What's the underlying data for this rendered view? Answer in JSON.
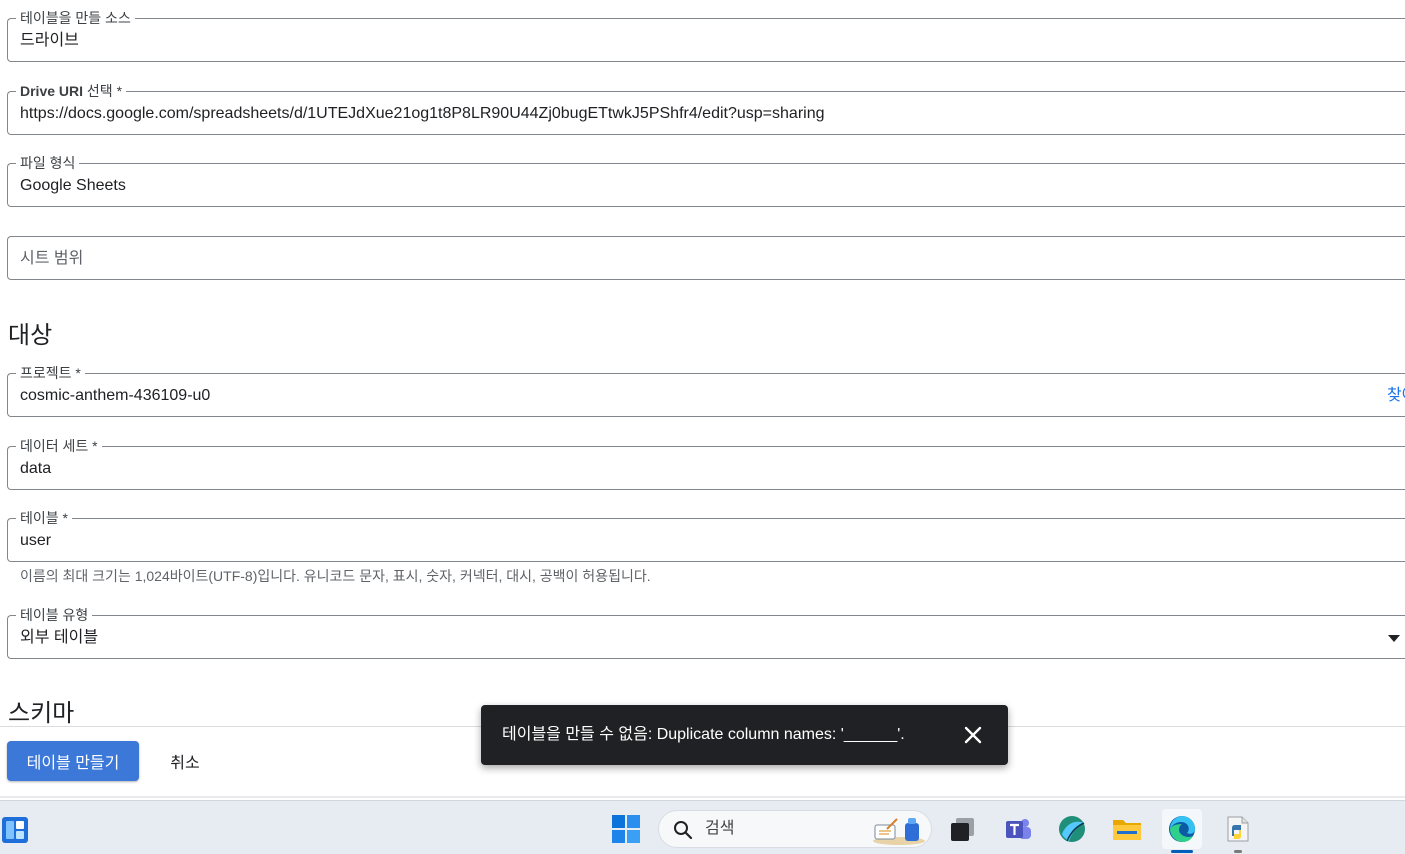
{
  "form": {
    "source": {
      "label": "테이블을 만들 소스",
      "value": "드라이브"
    },
    "drive_uri": {
      "label": "Drive URI",
      "label_suffix": " 선택 *",
      "value": "https://docs.google.com/spreadsheets/d/1UTEJdXue21og1t8P8LR90U44Zj0bugETtwkJ5PShfr4/edit?usp=sharing"
    },
    "file_format": {
      "label": "파일 형식",
      "value": "Google Sheets"
    },
    "sheet_range": {
      "placeholder": "시트 범위"
    },
    "destination_title": "대상",
    "project": {
      "label": "프로젝트 *",
      "value": "cosmic-anthem-436109-u0",
      "browse": "찾아보기"
    },
    "dataset": {
      "label": "데이터 세트 *",
      "value": "data"
    },
    "table": {
      "label": "테이블 *",
      "value": "user",
      "hint": "이름의 최대 크기는 1,024바이트(UTF-8)입니다. 유니코드 문자, 표시, 숫자, 커넥터, 대시, 공백이 허용됩니다."
    },
    "table_type": {
      "label": "테이블 유형",
      "value": "외부 테이블"
    },
    "schema_title": "스키마"
  },
  "actions": {
    "create_label": "테이블 만들기",
    "cancel_label": "취소"
  },
  "snackbar": {
    "message": "테이블을 만들 수 없음: Duplicate column names: '______'."
  },
  "taskbar": {
    "search_label": "검색",
    "icons": [
      "widgets-icon",
      "start-icon",
      "search-icon",
      "task-view-icon",
      "teams-icon",
      "app-icon",
      "file-explorer-icon",
      "edge-icon",
      "python-icon"
    ]
  },
  "colors": {
    "primary": "#3c78d8",
    "snackbar_bg": "#202124",
    "link": "#1a73e8"
  }
}
